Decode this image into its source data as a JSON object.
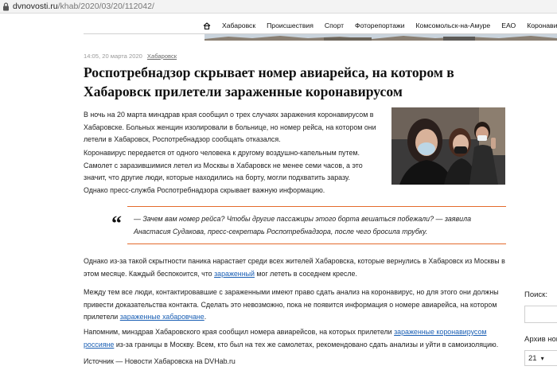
{
  "browser": {
    "url_host": "dvnovosti.ru",
    "url_path": "/khab/2020/03/20/112042/"
  },
  "nav": {
    "items": [
      "Хабаровск",
      "Происшествия",
      "Спорт",
      "Фоторепортажи",
      "Комсомольск-на-Амуре",
      "ЕАО",
      "Коронавирус"
    ]
  },
  "article": {
    "date": "14:05, 20 марта 2020",
    "category": "Хабаровск",
    "title": "Роспотребнадзор скрывает номер авиарейса, на котором в Хабаровск прилетели зараженные коронавирусом",
    "p1": {
      "l1": "В ночь на 20 марта минздрав края сообщил о трех случаях заражения коронавирусом в",
      "l2": "Хабаровске. Больных женщин изолировали в больнице, но номер рейса, на котором они",
      "l3": "летели в Хабаровск, Роспотребнадзор сообщать отказался."
    },
    "p2": {
      "l1": "Коронавирус передается от одного человека к другому воздушно-капельным путем.",
      "l2": "Самолет с заразившимися летел из Москвы в Хабаровск не менее семи часов, а это",
      "l3": "значит, что другие люди, которые находились на борту, могли подхватить заразу.",
      "l4": "Однако пресс-служба Роспотребнадзора скрывает важную информацию."
    },
    "quote": {
      "mark": "“",
      "l1": "— Зачем вам номер рейса? Чтобы другие пассажиры этого борта вешаться побежали? — заявила",
      "l2": "Анастасия Судакова, пресс-секретарь Роспотребнадзора, после чего бросила трубку."
    },
    "p3": {
      "l1": "Однако из-за такой скрытности паника нарастает среди всех жителей Хабаровска, которые вернулись в Хабаровск из Москвы в",
      "l2_a": "этом месяце. Каждый беспокоится, что ",
      "l2_link": "зараженный",
      "l2_b": " мог лететь в соседнем кресле."
    },
    "p4": {
      "l1": "Между тем все люди, контактировавшие с зараженными имеют право сдать анализ на коронавирус, но для этого они должны",
      "l2": "привести доказательства контакта. Сделать это невозможно, пока не появится информация о номере авиарейса, на котором",
      "l3_a": "прилетели ",
      "l3_link": "зараженные хабаровчане",
      "l3_b": "."
    },
    "p5": {
      "l1_a": "Напомним, минздрав Хабаровского края сообщил номера авиарейсов, на которых прилетели ",
      "l1_link": "зараженные коронавирусом",
      "l2_link": "россияне",
      "l2_b": " из-за границы в Москву. Всем, кто был на тех же самолетах, рекомендовано сдать анализы и уйти в самоизоляцию."
    },
    "source": "Источник — Новости Хабаровска на DVHab.ru"
  },
  "sidebar": {
    "search_label": "Поиск:",
    "archive_label": "Архив нов",
    "archive_value": "21"
  },
  "colors": {
    "accent": "#e46b2c",
    "link": "#1a5fb4"
  }
}
